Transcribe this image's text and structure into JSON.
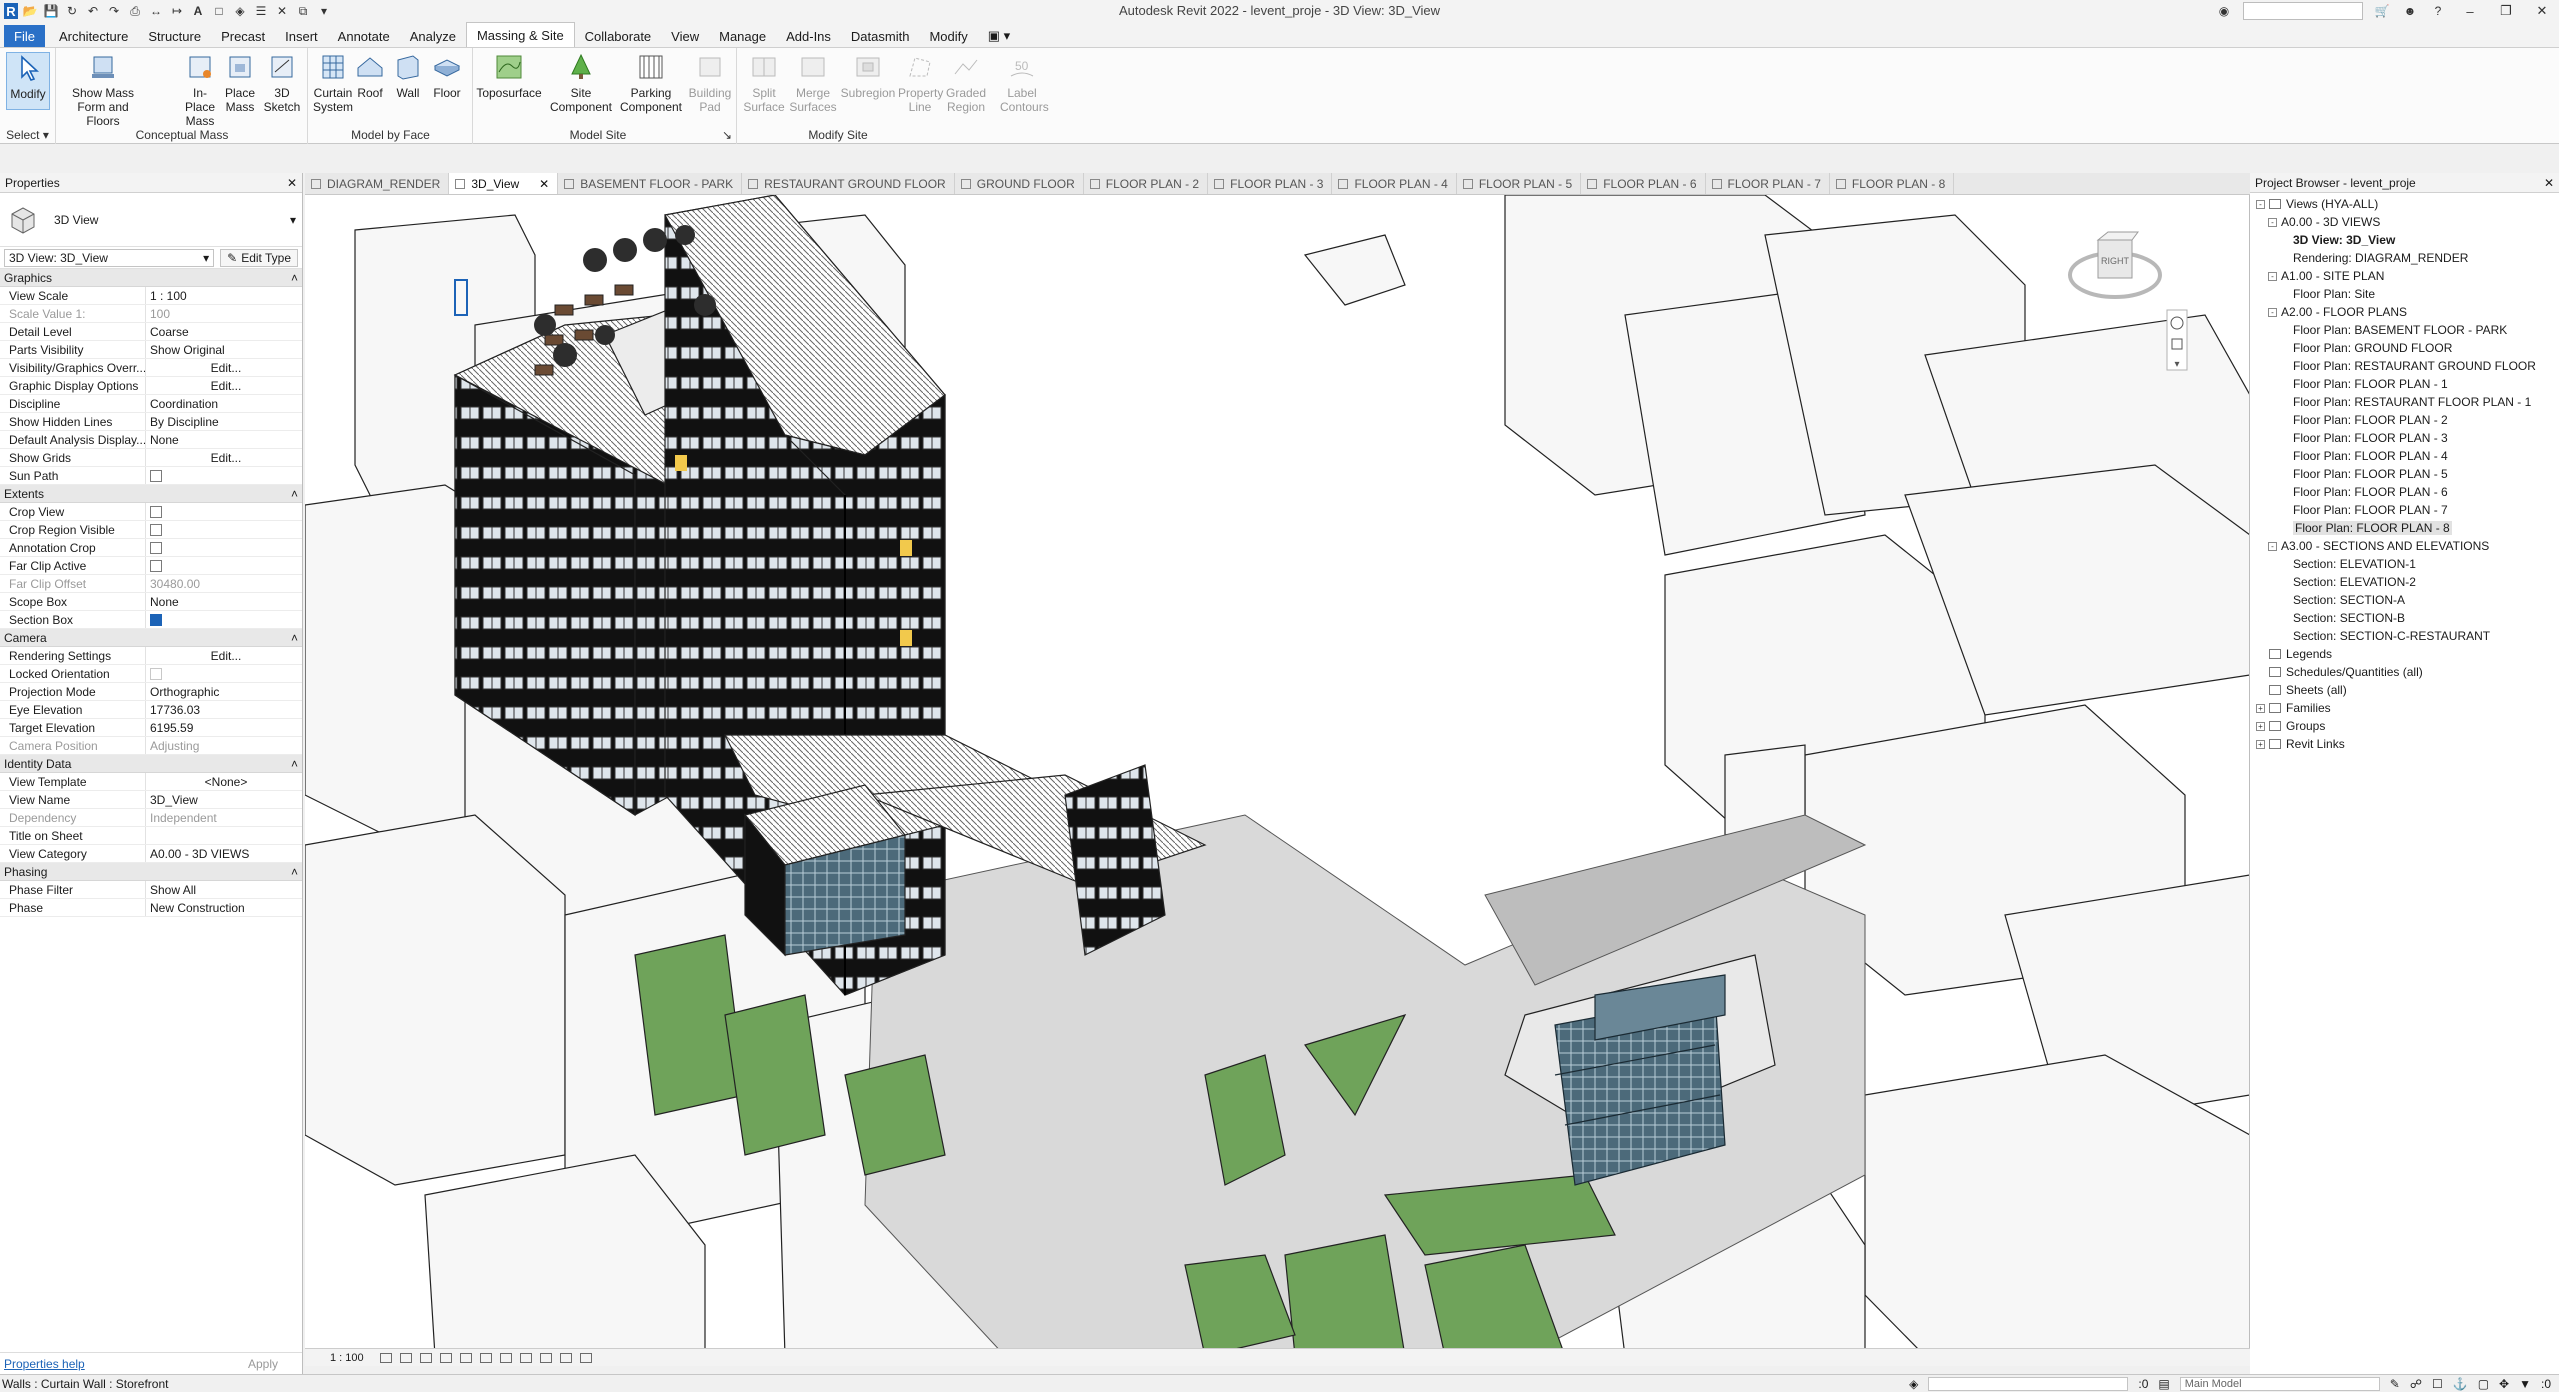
{
  "app": {
    "title": "Autodesk Revit 2022 - levent_proje - 3D View: 3D_View"
  },
  "ribbon": {
    "tabs": [
      "File",
      "Architecture",
      "Structure",
      "Precast",
      "Insert",
      "Annotate",
      "Analyze",
      "Massing & Site",
      "Collaborate",
      "View",
      "Manage",
      "Add-Ins",
      "Datasmith",
      "Modify"
    ],
    "active_tab": "Massing & Site",
    "groups": {
      "select": "Select",
      "conceptual_mass": "Conceptual Mass",
      "model_by_face": "Model by Face",
      "model_site": "Model Site",
      "modify_site": "Modify Site"
    },
    "buttons": {
      "modify": "Modify",
      "show_mass": "Show Mass Form and Floors",
      "in_place_mass": "In-Place Mass",
      "place_mass": "Place Mass",
      "sketch_3d": "3D Sketch",
      "curtain_system": "Curtain System",
      "roof": "Roof",
      "wall": "Wall",
      "floor": "Floor",
      "toposurface": "Toposurface",
      "site_component": "Site Component",
      "parking_component": "Parking Component",
      "building_pad": "Building Pad",
      "split_surface": "Split Surface",
      "merge_surfaces": "Merge Surfaces",
      "subregion": "Subregion",
      "property_line": "Property Line",
      "graded_region": "Graded Region",
      "label_contours": "Label Contours"
    }
  },
  "properties": {
    "header": "Properties",
    "type_name": "3D View",
    "instance": "3D View: 3D_View",
    "edit_type": "Edit Type",
    "help": "Properties help",
    "apply": "Apply",
    "categories": [
      {
        "name": "Graphics",
        "rows": [
          {
            "name": "View Scale",
            "value": "1 : 100",
            "kind": "text"
          },
          {
            "name": "Scale Value    1:",
            "value": "100",
            "kind": "grey"
          },
          {
            "name": "Detail Level",
            "value": "Coarse",
            "kind": "text"
          },
          {
            "name": "Parts Visibility",
            "value": "Show Original",
            "kind": "text"
          },
          {
            "name": "Visibility/Graphics Overr...",
            "value": "Edit...",
            "kind": "button"
          },
          {
            "name": "Graphic Display Options",
            "value": "Edit...",
            "kind": "button"
          },
          {
            "name": "Discipline",
            "value": "Coordination",
            "kind": "text"
          },
          {
            "name": "Show Hidden Lines",
            "value": "By Discipline",
            "kind": "text"
          },
          {
            "name": "Default Analysis Display...",
            "value": "None",
            "kind": "text"
          },
          {
            "name": "Show Grids",
            "value": "Edit...",
            "kind": "button"
          },
          {
            "name": "Sun Path",
            "value": "",
            "kind": "check"
          }
        ]
      },
      {
        "name": "Extents",
        "rows": [
          {
            "name": "Crop View",
            "value": "",
            "kind": "check"
          },
          {
            "name": "Crop Region Visible",
            "value": "",
            "kind": "check"
          },
          {
            "name": "Annotation Crop",
            "value": "",
            "kind": "check"
          },
          {
            "name": "Far Clip Active",
            "value": "",
            "kind": "check"
          },
          {
            "name": "Far Clip Offset",
            "value": "30480.00",
            "kind": "grey"
          },
          {
            "name": "Scope Box",
            "value": "None",
            "kind": "text"
          },
          {
            "name": "Section Box",
            "value": "",
            "kind": "check-on"
          }
        ]
      },
      {
        "name": "Camera",
        "rows": [
          {
            "name": "Rendering Settings",
            "value": "Edit...",
            "kind": "button"
          },
          {
            "name": "Locked Orientation",
            "value": "",
            "kind": "check-grey"
          },
          {
            "name": "Projection Mode",
            "value": "Orthographic",
            "kind": "text"
          },
          {
            "name": "Eye Elevation",
            "value": "17736.03",
            "kind": "text"
          },
          {
            "name": "Target Elevation",
            "value": "6195.59",
            "kind": "text"
          },
          {
            "name": "Camera Position",
            "value": "Adjusting",
            "kind": "grey"
          }
        ]
      },
      {
        "name": "Identity Data",
        "rows": [
          {
            "name": "View Template",
            "value": "<None>",
            "kind": "button"
          },
          {
            "name": "View Name",
            "value": "3D_View",
            "kind": "text"
          },
          {
            "name": "Dependency",
            "value": "Independent",
            "kind": "grey"
          },
          {
            "name": "Title on Sheet",
            "value": "",
            "kind": "text"
          },
          {
            "name": "View Category",
            "value": "A0.00 - 3D VIEWS",
            "kind": "text"
          }
        ]
      },
      {
        "name": "Phasing",
        "rows": [
          {
            "name": "Phase Filter",
            "value": "Show All",
            "kind": "text"
          },
          {
            "name": "Phase",
            "value": "New Construction",
            "kind": "text"
          }
        ]
      }
    ]
  },
  "view_tabs": [
    {
      "label": "DIAGRAM_RENDER",
      "active": false
    },
    {
      "label": "3D_View",
      "active": true
    },
    {
      "label": "BASEMENT FLOOR - PARK",
      "active": false
    },
    {
      "label": "RESTAURANT GROUND FLOOR",
      "active": false
    },
    {
      "label": "GROUND FLOOR",
      "active": false
    },
    {
      "label": "FLOOR PLAN - 2",
      "active": false
    },
    {
      "label": "FLOOR PLAN - 3",
      "active": false
    },
    {
      "label": "FLOOR PLAN - 4",
      "active": false
    },
    {
      "label": "FLOOR PLAN - 5",
      "active": false
    },
    {
      "label": "FLOOR PLAN - 6",
      "active": false
    },
    {
      "label": "FLOOR PLAN - 7",
      "active": false
    },
    {
      "label": "FLOOR PLAN - 8",
      "active": false
    }
  ],
  "viewcube_label": "RIGHT",
  "view_scale": "1 : 100",
  "browser": {
    "header": "Project Browser - levent_proje",
    "nodes": [
      {
        "label": "Views (HYA-ALL)",
        "level": 0,
        "toggle": "-",
        "icon": true
      },
      {
        "label": "A0.00 - 3D VIEWS",
        "level": 1,
        "toggle": "-"
      },
      {
        "label": "3D View: 3D_View",
        "level": 2,
        "style": "sel"
      },
      {
        "label": "Rendering: DIAGRAM_RENDER",
        "level": 2
      },
      {
        "label": "A1.00 - SITE PLAN",
        "level": 1,
        "toggle": "-"
      },
      {
        "label": "Floor Plan: Site",
        "level": 2
      },
      {
        "label": "A2.00 - FLOOR PLANS",
        "level": 1,
        "toggle": "-"
      },
      {
        "label": "Floor Plan: BASEMENT FLOOR - PARK",
        "level": 2
      },
      {
        "label": "Floor Plan: GROUND FLOOR",
        "level": 2
      },
      {
        "label": "Floor Plan: RESTAURANT GROUND FLOOR",
        "level": 2
      },
      {
        "label": "Floor Plan: FLOOR PLAN - 1",
        "level": 2
      },
      {
        "label": "Floor Plan: RESTAURANT FLOOR PLAN - 1",
        "level": 2
      },
      {
        "label": "Floor Plan: FLOOR PLAN - 2",
        "level": 2
      },
      {
        "label": "Floor Plan: FLOOR PLAN - 3",
        "level": 2
      },
      {
        "label": "Floor Plan: FLOOR PLAN - 4",
        "level": 2
      },
      {
        "label": "Floor Plan: FLOOR PLAN - 5",
        "level": 2
      },
      {
        "label": "Floor Plan: FLOOR PLAN - 6",
        "level": 2
      },
      {
        "label": "Floor Plan: FLOOR PLAN - 7",
        "level": 2
      },
      {
        "label": "Floor Plan: FLOOR PLAN - 8",
        "level": 2,
        "style": "hl"
      },
      {
        "label": "A3.00 - SECTIONS AND ELEVATIONS",
        "level": 1,
        "toggle": "-"
      },
      {
        "label": "Section: ELEVATION-1",
        "level": 2
      },
      {
        "label": "Section: ELEVATION-2",
        "level": 2
      },
      {
        "label": "Section: SECTION-A",
        "level": 2
      },
      {
        "label": "Section: SECTION-B",
        "level": 2
      },
      {
        "label": "Section: SECTION-C-RESTAURANT",
        "level": 2
      },
      {
        "label": "Legends",
        "level": 0,
        "icon": true
      },
      {
        "label": "Schedules/Quantities (all)",
        "level": 0,
        "icon": true
      },
      {
        "label": "Sheets (all)",
        "level": 0,
        "icon": true
      },
      {
        "label": "Families",
        "level": 0,
        "toggle": "+",
        "icon": true
      },
      {
        "label": "Groups",
        "level": 0,
        "toggle": "+",
        "icon": true
      },
      {
        "label": "Revit Links",
        "level": 0,
        "toggle": "+",
        "icon": true
      }
    ]
  },
  "status": {
    "text": "Walls : Curtain Wall : Storefront",
    "coord": ":0",
    "model": "Main Model"
  }
}
